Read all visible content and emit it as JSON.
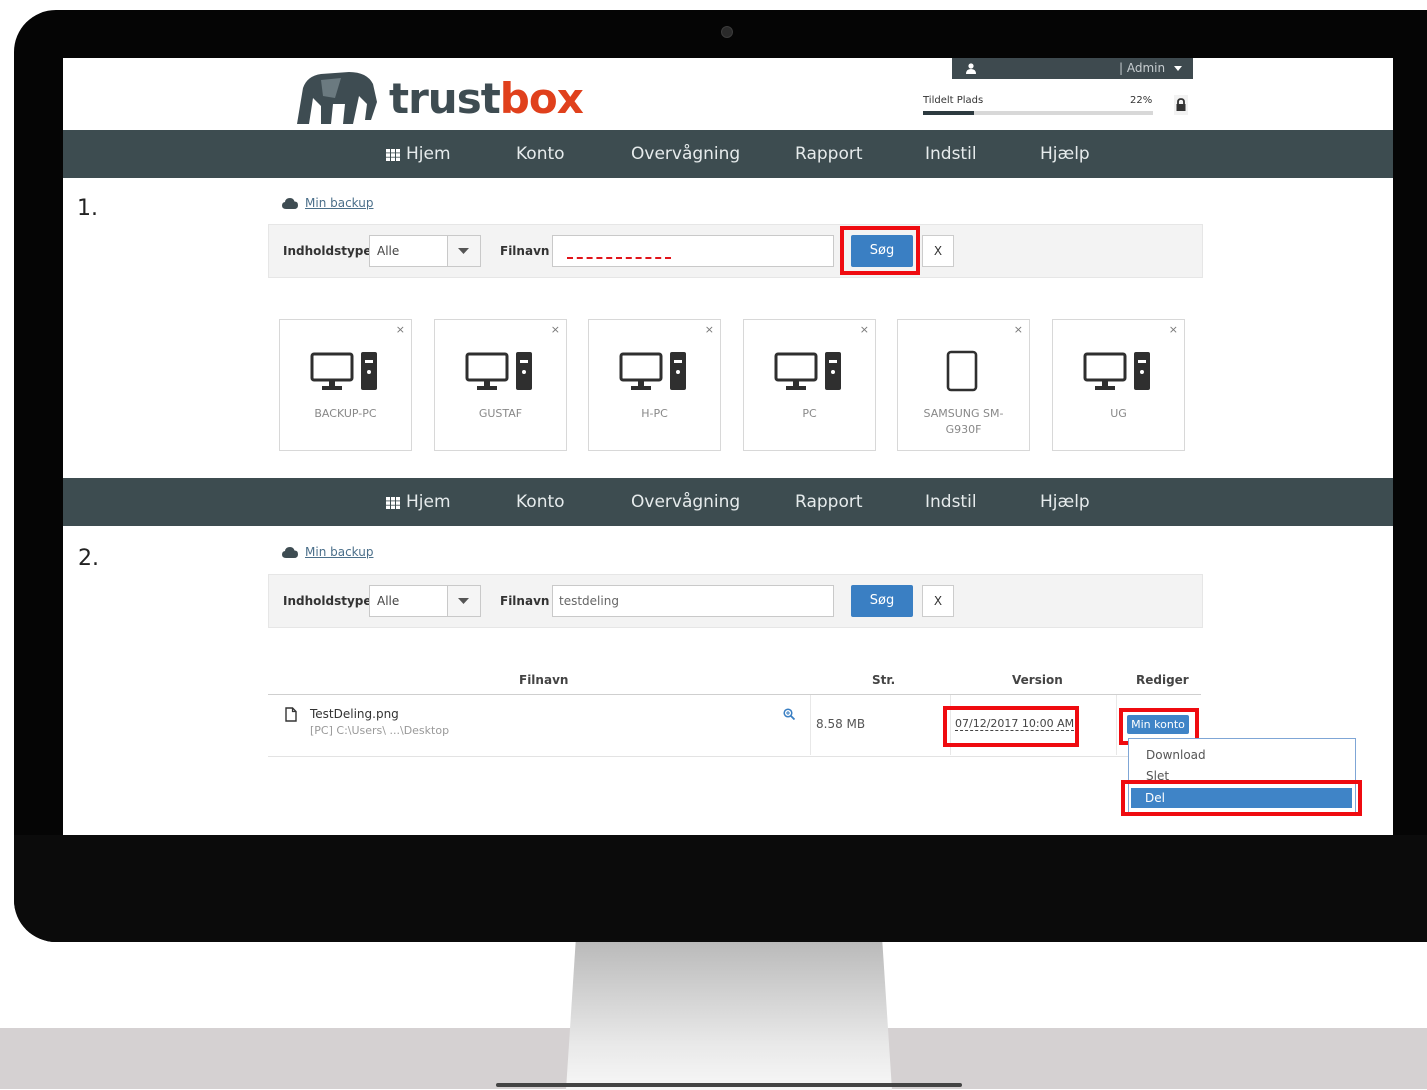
{
  "brand": {
    "name_part1": "trust",
    "name_part2": "box"
  },
  "account": {
    "user_label": "| Admin",
    "quota_label": "Tildelt Plads",
    "quota_percent_text": "22%",
    "quota_fraction": 0.22
  },
  "nav": {
    "home": "Hjem",
    "account": "Konto",
    "monitoring": "Overvågning",
    "report": "Rapport",
    "settings": "Indstil",
    "help": "Hjælp"
  },
  "step1": {
    "number": "1.",
    "breadcrumb": "Min backup",
    "filter": {
      "type_label": "Indholdstype",
      "type_value": "Alle",
      "filename_label": "Filnavn",
      "filename_value": "",
      "search_label": "Søg",
      "clear_label": "X"
    },
    "devices": [
      {
        "name": "BACKUP-PC",
        "icon": "desktop-icon"
      },
      {
        "name": "GUSTAF",
        "icon": "desktop-icon"
      },
      {
        "name": "H-PC",
        "icon": "desktop-icon"
      },
      {
        "name": "PC",
        "icon": "desktop-icon"
      },
      {
        "name": "SAMSUNG SM-G930F",
        "icon": "phone-icon"
      },
      {
        "name": "UG",
        "icon": "desktop-icon"
      }
    ]
  },
  "step2": {
    "number": "2.",
    "breadcrumb": "Min backup",
    "filter": {
      "type_label": "Indholdstype",
      "type_value": "Alle",
      "filename_label": "Filnavn",
      "filename_value": "testdeling",
      "search_label": "Søg",
      "clear_label": "X"
    },
    "table": {
      "headers": {
        "filename": "Filnavn",
        "size": "Str.",
        "version": "Version",
        "edit": "Rediger"
      },
      "rows": [
        {
          "filename": "TestDeling.png",
          "path": "[PC] C:\\Users\\ ...\\Desktop",
          "size": "8.58 MB",
          "version": "07/12/2017 10:00 AM",
          "action": "Min konto"
        }
      ]
    },
    "menu": {
      "download": "Download",
      "delete": "Slet",
      "share": "Del"
    }
  },
  "colors": {
    "accent": "#3a7fc3",
    "nav_bg": "#3d4c50",
    "highlight": "#ef0b10",
    "brand_orange": "#e0401c"
  }
}
